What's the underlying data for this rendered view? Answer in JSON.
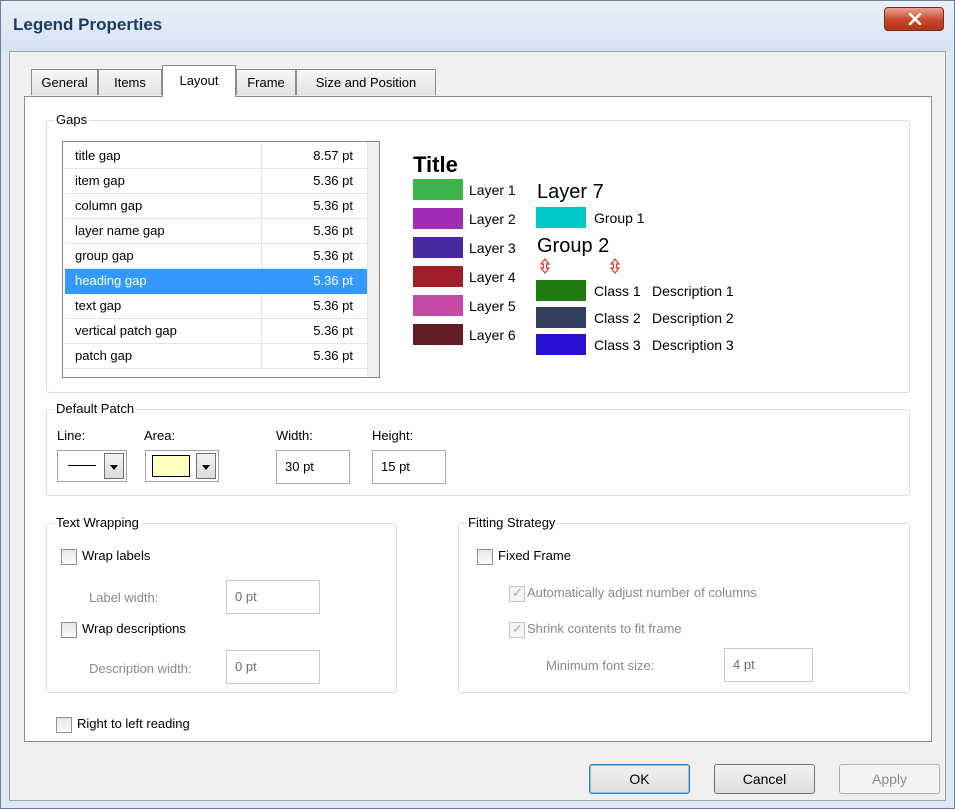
{
  "window": {
    "title": "Legend Properties",
    "close_glyph": "x"
  },
  "tabs": [
    {
      "label": "General"
    },
    {
      "label": "Items"
    },
    {
      "label": "Layout"
    },
    {
      "label": "Frame"
    },
    {
      "label": "Size and Position"
    }
  ],
  "gaps": {
    "title": "Gaps",
    "rows": [
      {
        "name": "title gap",
        "value": "8.57 pt"
      },
      {
        "name": "item gap",
        "value": "5.36 pt"
      },
      {
        "name": "column gap",
        "value": "5.36 pt"
      },
      {
        "name": "layer name gap",
        "value": "5.36 pt"
      },
      {
        "name": "group gap",
        "value": "5.36 pt"
      },
      {
        "name": "heading gap",
        "value": "5.36 pt"
      },
      {
        "name": "text gap",
        "value": "5.36 pt"
      },
      {
        "name": "vertical patch gap",
        "value": "5.36 pt"
      },
      {
        "name": "patch gap",
        "value": "5.36 pt"
      }
    ],
    "selected": "heading gap"
  },
  "preview": {
    "title": "Title",
    "layers": [
      {
        "label": "Layer 1",
        "color": "#3cb44b"
      },
      {
        "label": "Layer 2",
        "color": "#a02db4"
      },
      {
        "label": "Layer 3",
        "color": "#4a2aa0"
      },
      {
        "label": "Layer 4",
        "color": "#a01e28"
      },
      {
        "label": "Layer 5",
        "color": "#c44aa6"
      },
      {
        "label": "Layer 6",
        "color": "#641e23"
      }
    ],
    "layer7": "Layer 7",
    "group1": {
      "label": "Group 1",
      "color": "#00c8c8"
    },
    "group2": "Group 2",
    "classes": [
      {
        "label": "Class 1",
        "description": "Description 1",
        "color": "#1f7a10"
      },
      {
        "label": "Class 2",
        "description": "Description 2",
        "color": "#33405c"
      },
      {
        "label": "Class 3",
        "description": "Description 3",
        "color": "#2a10d2"
      }
    ],
    "arrow_color": "#e03c32"
  },
  "default_patch": {
    "title": "Default Patch",
    "line_label": "Line:",
    "area_label": "Area:",
    "area_color": "#ffffc0",
    "width_label": "Width:",
    "width_value": "30 pt",
    "height_label": "Height:",
    "height_value": "15 pt"
  },
  "text_wrapping": {
    "title": "Text Wrapping",
    "wrap_labels": "Wrap labels",
    "label_width_label": "Label width:",
    "label_width_value": "0 pt",
    "wrap_descriptions": "Wrap descriptions",
    "description_width_label": "Description width:",
    "description_width_value": "0 pt"
  },
  "fitting_strategy": {
    "title": "Fitting Strategy",
    "fixed_frame": "Fixed Frame",
    "auto_adjust": "Automatically adjust number of columns",
    "shrink": "Shrink contents to fit frame",
    "min_font_label": "Minimum font size:",
    "min_font_value": "4 pt"
  },
  "right_to_left": "Right to left reading",
  "buttons": {
    "ok": "OK",
    "cancel": "Cancel",
    "apply": "Apply"
  }
}
